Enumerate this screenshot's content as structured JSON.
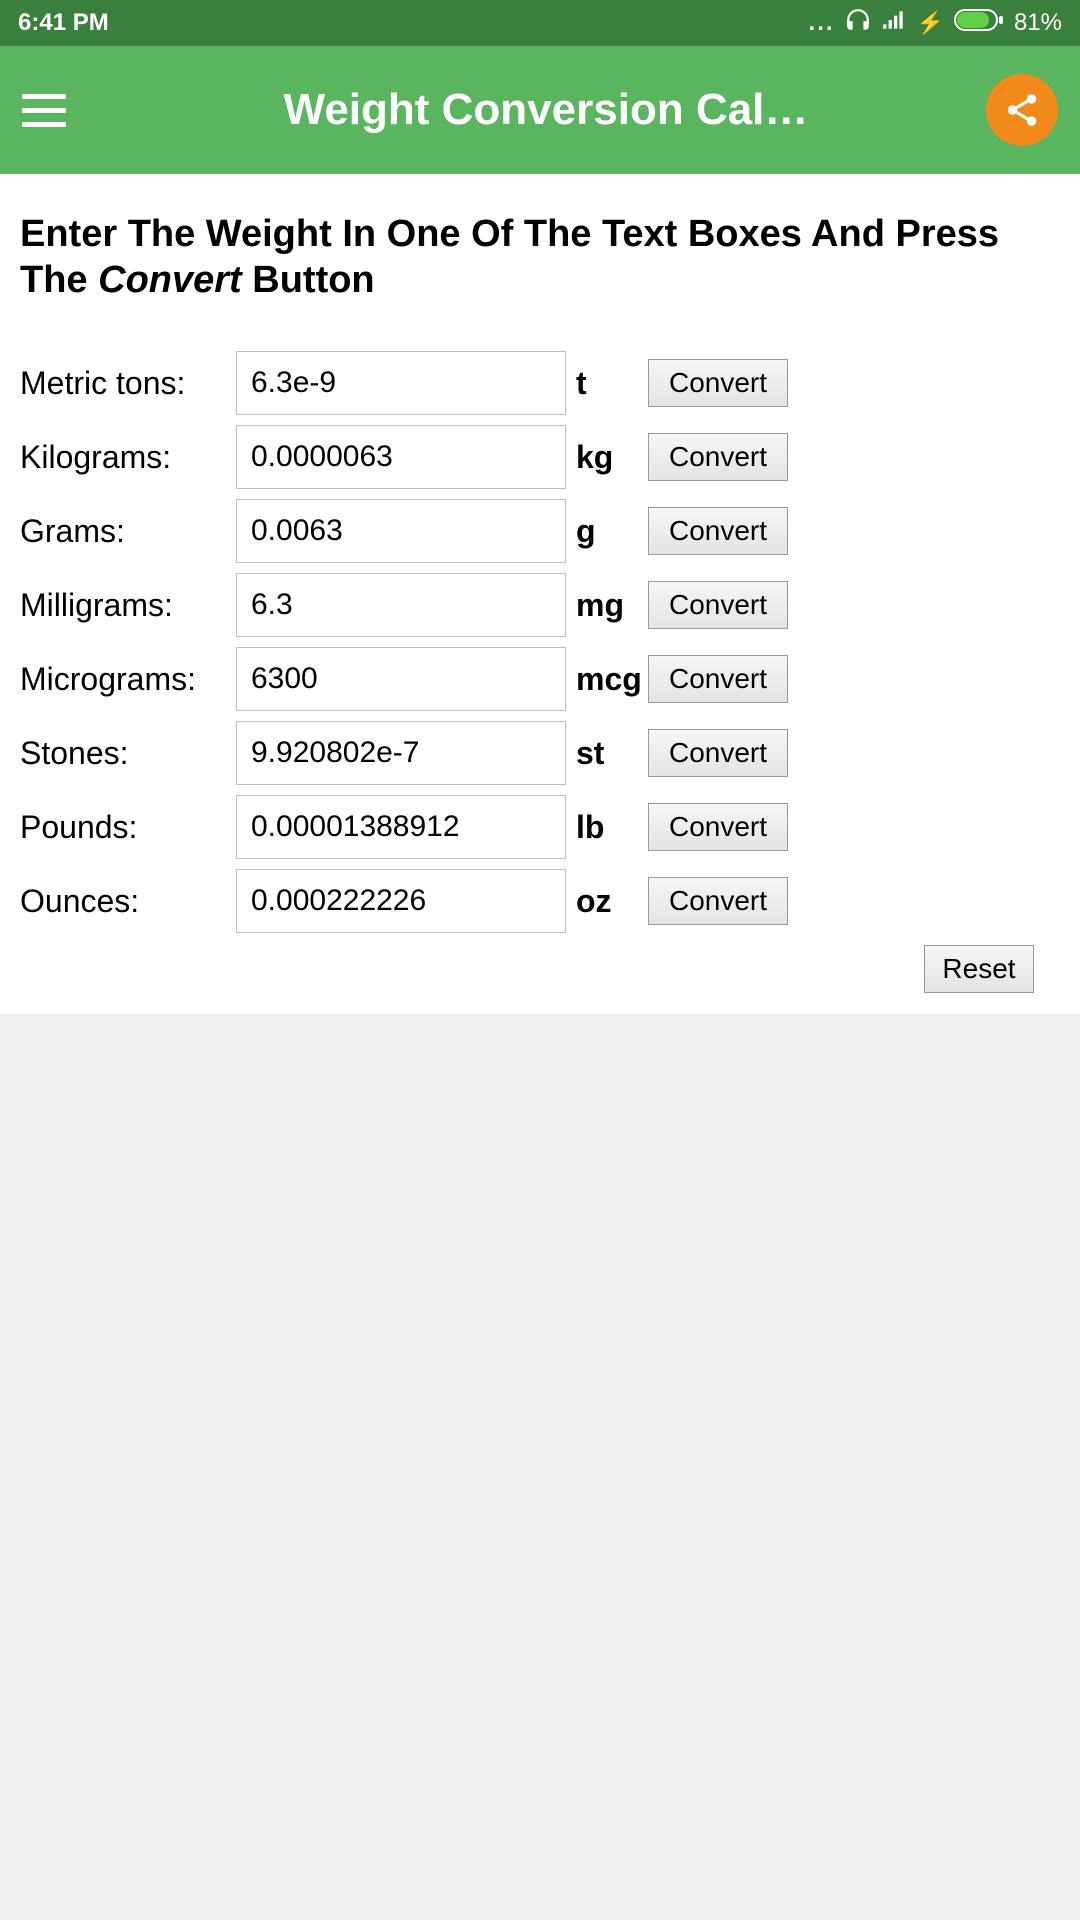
{
  "status": {
    "time": "6:41 PM",
    "battery_pct": "81%"
  },
  "appbar": {
    "title": "Weight Conversion Cal…"
  },
  "content": {
    "instruction_prefix": "Enter The Weight In One Of The Text Boxes And Press The ",
    "instruction_em": "Convert",
    "instruction_suffix": " Button",
    "convert_label": "Convert",
    "reset_label": "Reset",
    "units": [
      {
        "label": "Metric tons:",
        "value": "6.3e-9",
        "abbrev": "t"
      },
      {
        "label": "Kilograms:",
        "value": "0.0000063",
        "abbrev": "kg"
      },
      {
        "label": "Grams:",
        "value": "0.0063",
        "abbrev": "g"
      },
      {
        "label": "Milligrams:",
        "value": "6.3",
        "abbrev": "mg"
      },
      {
        "label": "Micrograms:",
        "value": "6300",
        "abbrev": "mcg"
      },
      {
        "label": "Stones:",
        "value": "9.920802e-7",
        "abbrev": "st"
      },
      {
        "label": "Pounds:",
        "value": "0.00001388912",
        "abbrev": "lb"
      },
      {
        "label": "Ounces:",
        "value": "0.000222226",
        "abbrev": "oz"
      }
    ]
  }
}
